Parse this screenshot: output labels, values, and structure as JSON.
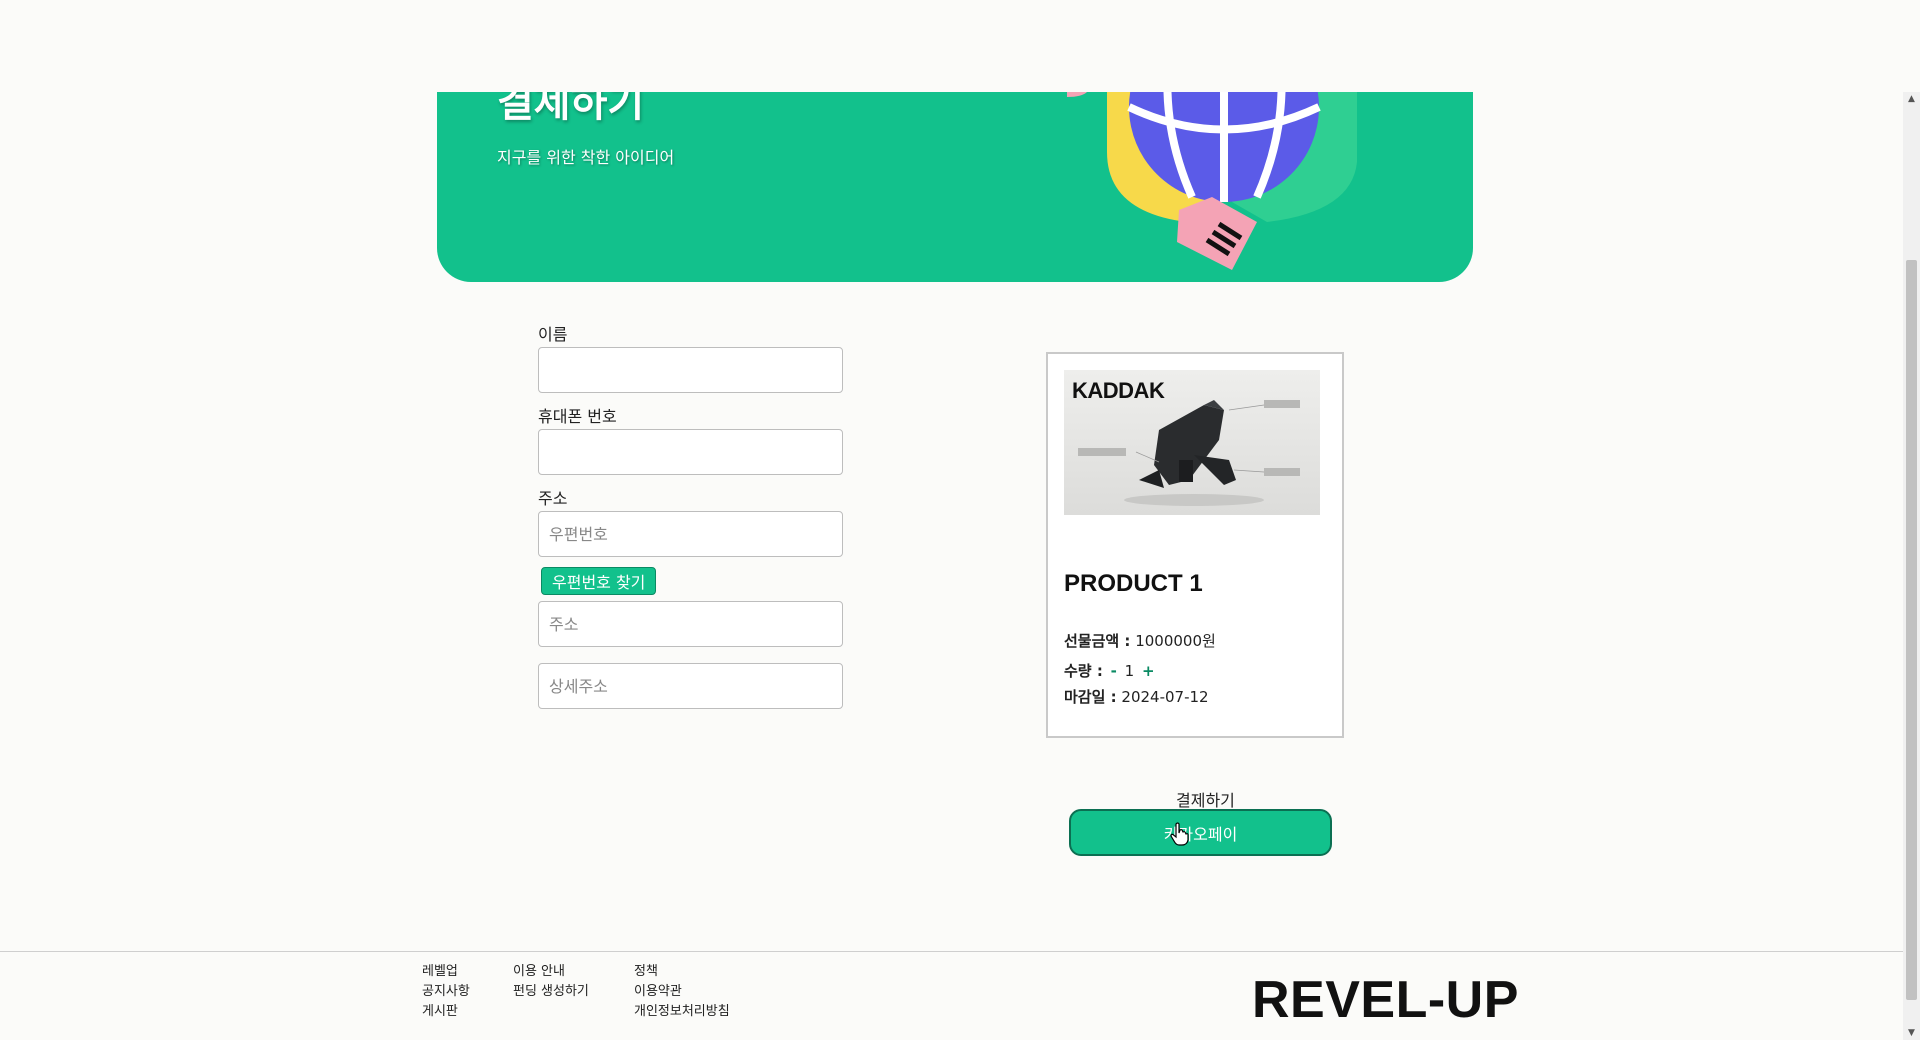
{
  "hero": {
    "title": "결제하기",
    "subtitle": "지구를 위한 착한 아이디어"
  },
  "form": {
    "name_label": "이름",
    "name_value": "",
    "phone_label": "휴대폰 번호",
    "phone_value": "",
    "address_label": "주소",
    "postcode_placeholder": "우편번호",
    "postcode_button": "우편번호 찾기",
    "address_placeholder": "주소",
    "detail_placeholder": "상세주소"
  },
  "product": {
    "brand": "KADDAK",
    "name": "PRODUCT 1",
    "price_label": "선물금액 :",
    "price_value": "1000000원",
    "qty_label": "수량 :",
    "qty_minus": "-",
    "qty_value": "1",
    "qty_plus": "+",
    "deadline_label": "마감일 :",
    "deadline_value": "2024-07-12"
  },
  "checkout": {
    "label": "결제하기",
    "kakao_button": "카카오페이"
  },
  "footer": {
    "col1": [
      "레벨업",
      "공지사항",
      "게시판"
    ],
    "col2": [
      "이용 안내",
      "펀딩 생성하기"
    ],
    "col3": [
      "정책",
      "이용약관",
      "개인정보처리방침"
    ],
    "logo": "REVEL-UP"
  },
  "colors": {
    "brand_green": "#12c18c",
    "button_border": "#0b6f52",
    "card_border": "#c9c9c9"
  }
}
